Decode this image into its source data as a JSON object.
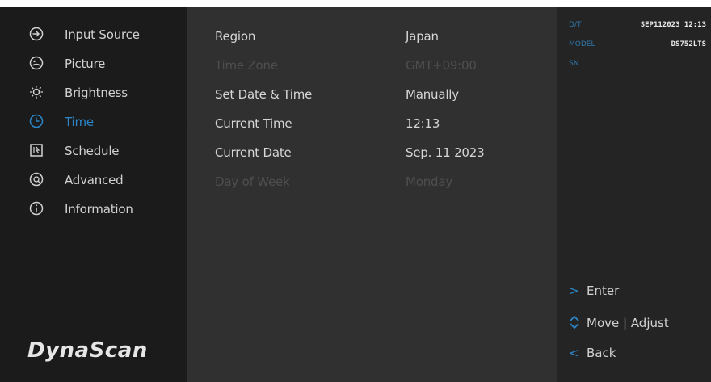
{
  "sidebar": {
    "items": [
      {
        "label": "Input Source",
        "icon": "input-source-icon"
      },
      {
        "label": "Picture",
        "icon": "picture-icon"
      },
      {
        "label": "Brightness",
        "icon": "brightness-icon"
      },
      {
        "label": "Time",
        "icon": "clock-icon",
        "active": true
      },
      {
        "label": "Schedule",
        "icon": "schedule-icon"
      },
      {
        "label": "Advanced",
        "icon": "advanced-icon"
      },
      {
        "label": "Information",
        "icon": "information-icon"
      }
    ],
    "logo": "DynaScan"
  },
  "settings": {
    "rows": [
      {
        "label": "Region",
        "value": "Japan",
        "enabled": true
      },
      {
        "label": "Time Zone",
        "value": "GMT+09:00",
        "enabled": false
      },
      {
        "label": "Set Date & Time",
        "value": "Manually",
        "enabled": true
      },
      {
        "label": "Current Time",
        "value": "12:13",
        "enabled": true
      },
      {
        "label": "Current Date",
        "value": "Sep. 11 2023",
        "enabled": true
      },
      {
        "label": "Day of Week",
        "value": "Monday",
        "enabled": false
      }
    ]
  },
  "info": {
    "dt_label": "D/T",
    "dt_value": "SEP112023 12:13",
    "model_label": "MODEL",
    "model_value": "DS752LTS",
    "sn_label": "SN",
    "sn_value": ""
  },
  "hints": {
    "enter_symbol": ">",
    "enter_label": "Enter",
    "move_label": "Move | Adjust",
    "back_symbol": "<",
    "back_label": "Back"
  },
  "colors": {
    "accent": "#2c87c8",
    "sidebar_bg": "#1b1b1b",
    "panel_bg": "#303030",
    "disabled_text": "#4e4e4e"
  }
}
